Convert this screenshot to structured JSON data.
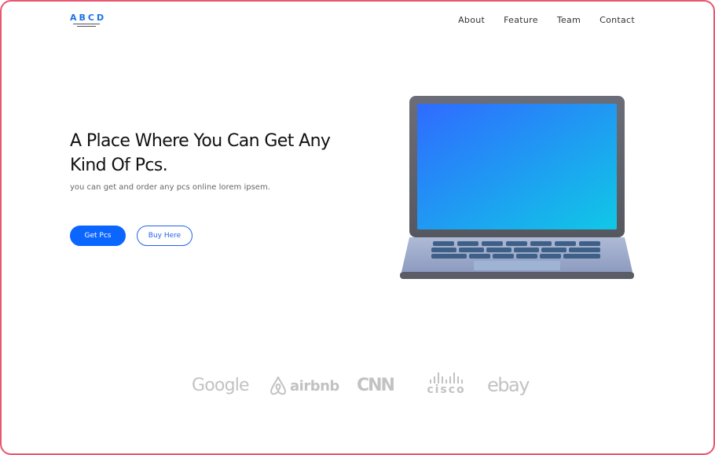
{
  "header": {
    "logo_text": "ABCD",
    "nav": [
      {
        "label": "About"
      },
      {
        "label": "Feature"
      },
      {
        "label": "Team"
      },
      {
        "label": "Contact"
      }
    ]
  },
  "hero": {
    "title": "A Place Where You Can Get Any Kind Of Pcs.",
    "subtitle": "you can get and order any pcs online lorem ipsem.",
    "primary_button": "Get Pcs",
    "secondary_button": "Buy Here",
    "image_icon": "laptop-illustration"
  },
  "brands": [
    {
      "name": "Google",
      "icon": "google-logo"
    },
    {
      "name": "airbnb",
      "icon": "airbnb-logo"
    },
    {
      "name": "CNN",
      "icon": "cnn-logo"
    },
    {
      "name": "cisco",
      "icon": "cisco-logo"
    },
    {
      "name": "ebay",
      "icon": "ebay-logo"
    }
  ],
  "colors": {
    "accent": "#0a66ff",
    "frame_border": "#e8566f",
    "brand_gray": "#c2c2c2"
  }
}
